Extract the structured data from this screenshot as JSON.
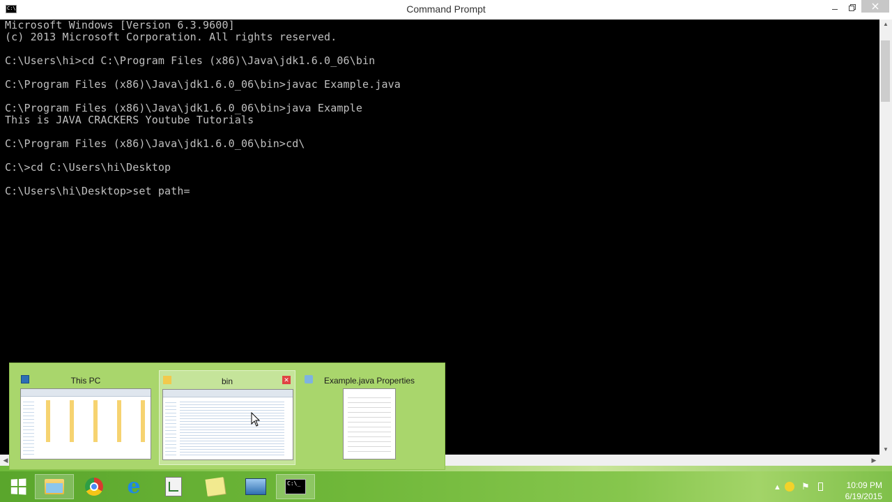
{
  "window": {
    "title": "Command Prompt",
    "icon_label": "C:\\",
    "buttons": {
      "minimize": "minimize-icon",
      "restore": "restore-icon",
      "close": "close-icon"
    }
  },
  "console": {
    "lines": [
      "Microsoft Windows [Version 6.3.9600]",
      "(c) 2013 Microsoft Corporation. All rights reserved.",
      "",
      "C:\\Users\\hi>cd C:\\Program Files (x86)\\Java\\jdk1.6.0_06\\bin",
      "",
      "C:\\Program Files (x86)\\Java\\jdk1.6.0_06\\bin>javac Example.java",
      "",
      "C:\\Program Files (x86)\\Java\\jdk1.6.0_06\\bin>java Example",
      "This is JAVA CRACKERS Youtube Tutorials",
      "",
      "C:\\Program Files (x86)\\Java\\jdk1.6.0_06\\bin>cd\\",
      "",
      "C:\\>cd C:\\Users\\hi\\Desktop",
      "",
      "C:\\Users\\hi\\Desktop>set path="
    ]
  },
  "thumbnails": [
    {
      "title": "This PC",
      "icon": "this-pc-icon",
      "hover": false,
      "close": false
    },
    {
      "title": "bin",
      "icon": "folder-icon",
      "hover": true,
      "close": true
    },
    {
      "title": "Example.java Properties",
      "icon": "properties-icon",
      "hover": false,
      "close": false
    }
  ],
  "taskbar": {
    "items": [
      {
        "name": "file-explorer",
        "icon": "folder-icon",
        "active": true
      },
      {
        "name": "chrome",
        "icon": "chrome-icon",
        "active": false
      },
      {
        "name": "internet-explorer",
        "icon": "ie-icon",
        "active": false
      },
      {
        "name": "editor",
        "icon": "editor-icon",
        "active": false
      },
      {
        "name": "sticky-notes",
        "icon": "sticky-notes-icon",
        "active": false
      },
      {
        "name": "window-app",
        "icon": "window-icon",
        "active": false
      },
      {
        "name": "command-prompt",
        "icon": "cmd-icon",
        "active": true
      }
    ]
  },
  "tray": {
    "time": "10:09 PM",
    "date": "6/19/2015"
  },
  "colors": {
    "console_bg": "#000000",
    "console_text": "#c0c0c0",
    "taskbar_accent": "#70b83a"
  }
}
